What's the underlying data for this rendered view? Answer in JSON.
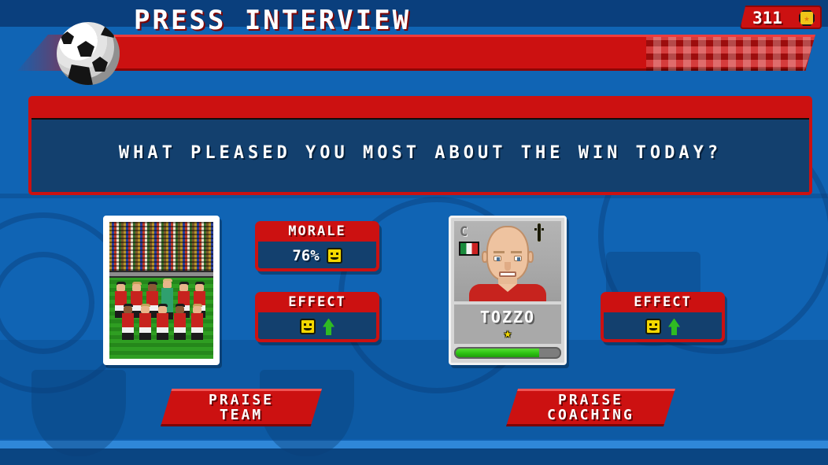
{
  "header": {
    "title": "PRESS INTERVIEW",
    "ball_icon": "soccer-ball-icon",
    "coin": {
      "value": "311",
      "icon": "gold-coin-star-icon",
      "star_glyph": "★"
    }
  },
  "question": {
    "text": "WHAT PLEASED YOU MOST ABOUT THE WIN TODAY?"
  },
  "team_option": {
    "photo_alt": "team-squad-photo",
    "morale": {
      "title": "MORALE",
      "value": "76%",
      "mood_icon": "smiley-face-icon"
    },
    "effect": {
      "title": "EFFECT",
      "mood_icon": "smiley-face-icon",
      "trend_icon": "green-up-arrow-icon"
    },
    "button": {
      "line1": "PRAISE",
      "line2": "TEAM"
    }
  },
  "player_option": {
    "card": {
      "captain_badge": "C",
      "nationality": "Italy",
      "flag_icon": "italy-flag-icon",
      "mood_icon": "smiley-face-icon",
      "name": "TOZZO",
      "star_glyph": "★",
      "condition_percent": 80
    },
    "effect": {
      "title": "EFFECT",
      "mood_icon": "smiley-face-icon",
      "trend_icon": "green-up-arrow-icon"
    },
    "button": {
      "line1": "PRAISE",
      "line2": "COACHING"
    }
  },
  "colors": {
    "red": "#cc1111",
    "red_dark": "#8e0606",
    "blue_bg": "#1064b4",
    "panel_navy": "#13406e",
    "white": "#ffffff",
    "green": "#2fbb22",
    "yellow": "#f4d800"
  }
}
